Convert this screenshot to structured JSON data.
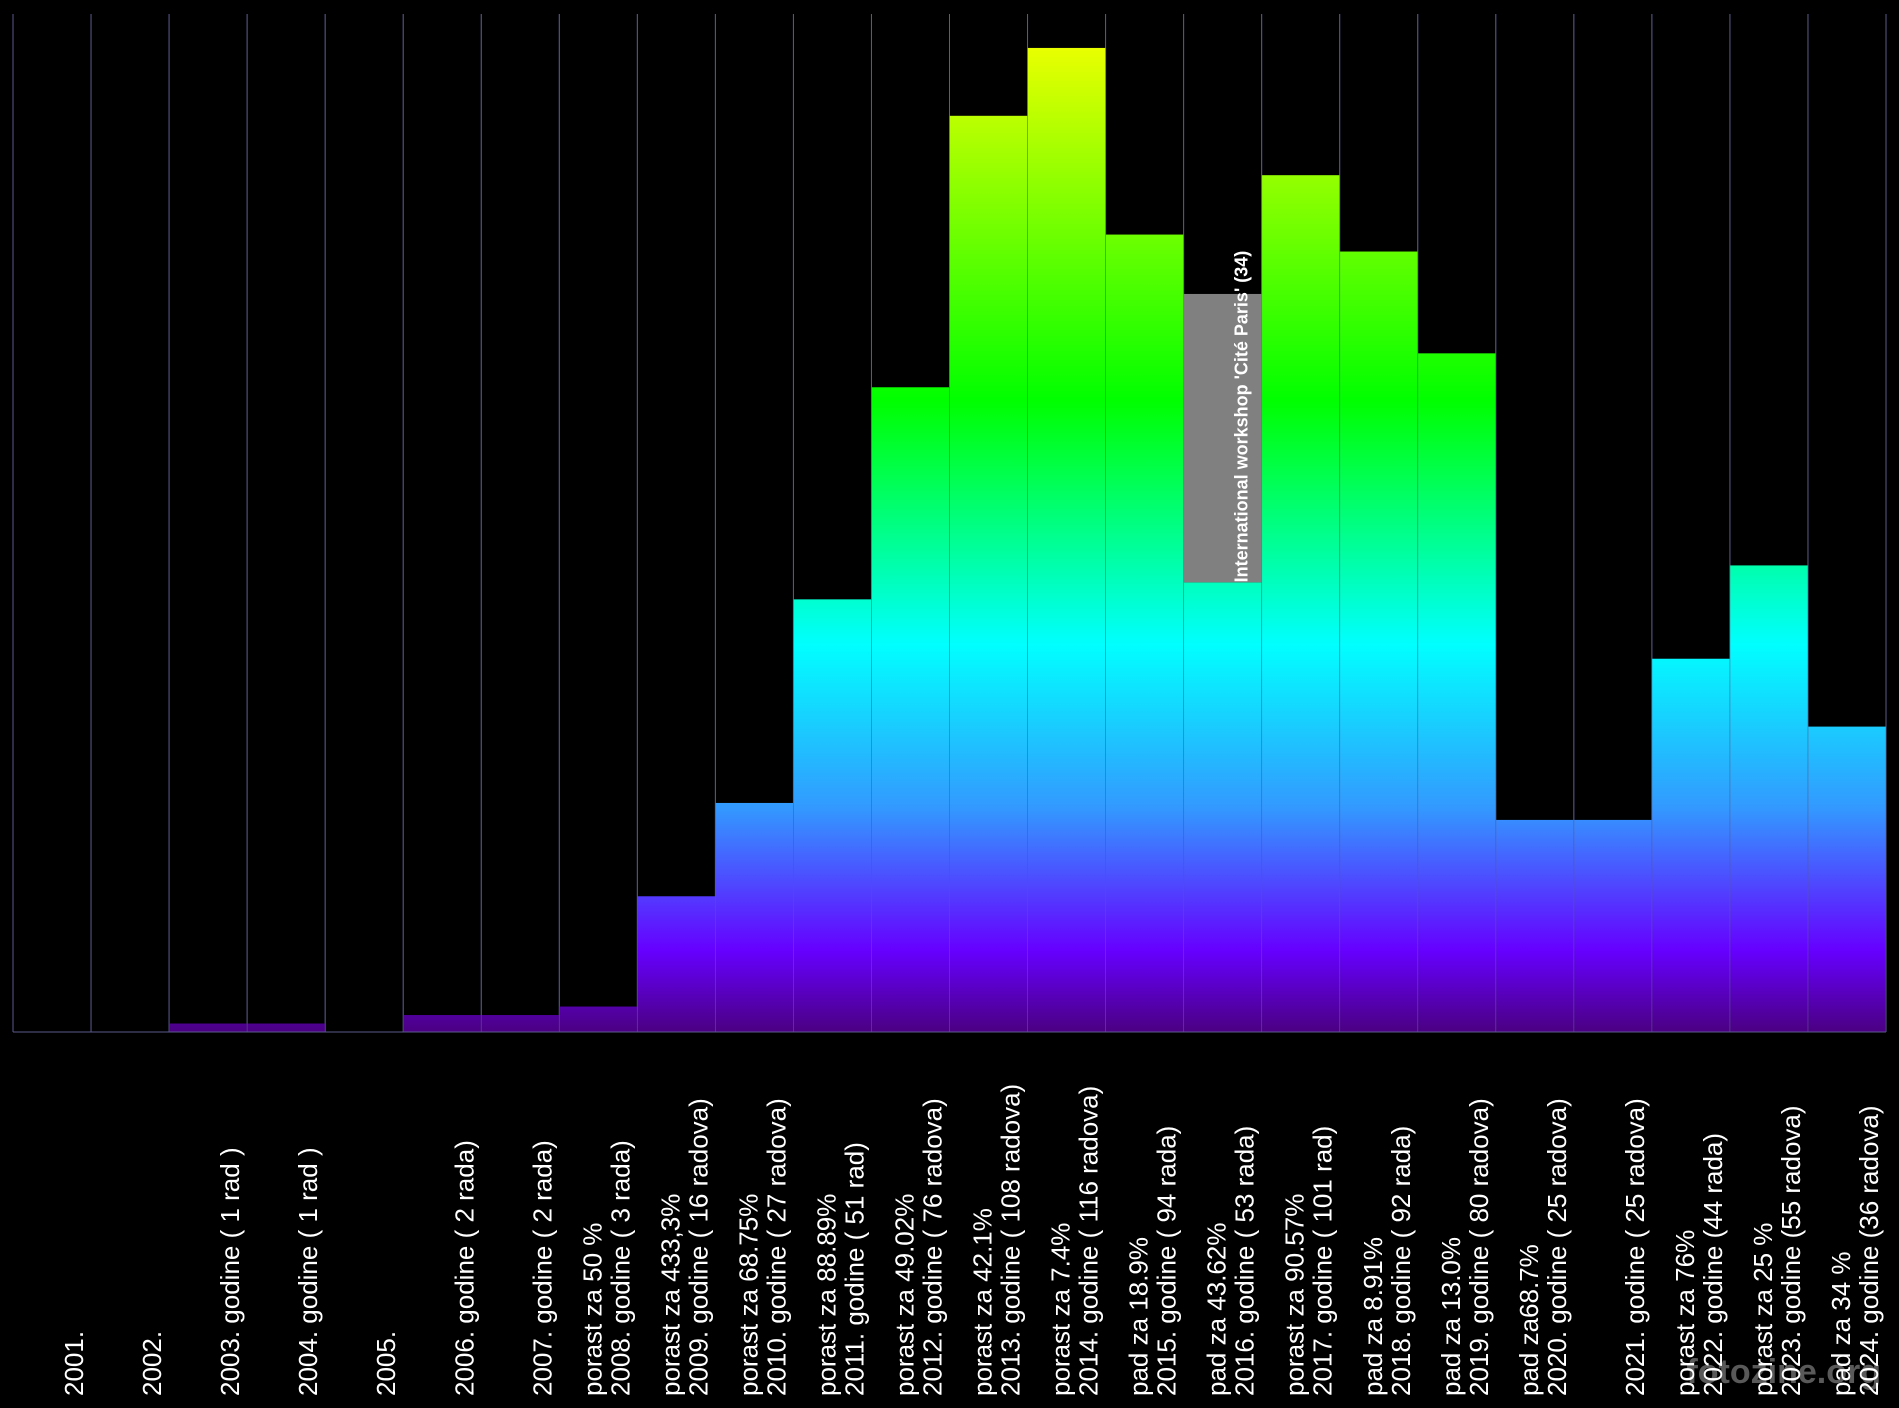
{
  "chart_data": {
    "type": "bar",
    "categories": [
      "2001.",
      "2002.",
      "2003.",
      "2004.",
      "2005.",
      "2006.",
      "2007.",
      "2008.",
      "2009.",
      "2010.",
      "2011.",
      "2012.",
      "2013.",
      "2014.",
      "2015.",
      "2016.",
      "2017.",
      "2018.",
      "2019.",
      "2020.",
      "2021.",
      "2022.",
      "2023.",
      "2024."
    ],
    "values": [
      0,
      0,
      1,
      1,
      0,
      2,
      2,
      3,
      16,
      27,
      51,
      76,
      108,
      116,
      94,
      53,
      101,
      92,
      80,
      25,
      25,
      44,
      55,
      36
    ],
    "labels": [
      [
        "2001."
      ],
      [
        "2002."
      ],
      [
        "2003. godine  ( 1 rad )"
      ],
      [
        "2004. godine  ( 1 rad )"
      ],
      [
        "2005."
      ],
      [
        "2006. godine  ( 2 rada)"
      ],
      [
        "2007. godine  ( 2 rada)"
      ],
      [
        "porast za 50 %",
        "2008. godine  ( 3 rada)"
      ],
      [
        "porast za 433,3%",
        "2009. godine  ( 16 radova)"
      ],
      [
        "porast za 68.75%",
        "2010. godine  ( 27 radova)"
      ],
      [
        "porast za 88.89%",
        "2011. godine  ( 51 rad)"
      ],
      [
        "porast za 49.02%",
        "2012. godine  ( 76 radova)"
      ],
      [
        "porast za 42.1%",
        "2013. godine  ( 108 radova)"
      ],
      [
        "porast za 7.4%",
        "2014. godine  ( 116 radova)"
      ],
      [
        "pad za 18.9%",
        "2015. godine  ( 94 rada)"
      ],
      [
        "pad za 43.62%",
        "2016. godine  ( 53 rada)"
      ],
      [
        "porast za 90.57%",
        "2017. godine  ( 101 rad)"
      ],
      [
        "pad za 8.91%",
        "2018. godine ( 92 rada)"
      ],
      [
        "pad za 13.0%",
        "2019. godine ( 80 radova)"
      ],
      [
        "pad za68.7%",
        "2020. godine ( 25 radova)"
      ],
      [
        "2021. godine ( 25 radova)"
      ],
      [
        "porast za 76%",
        "2022. godine (44 rada)"
      ],
      [
        "porast za 25 %",
        "2023. godine (55 radova)"
      ],
      [
        "pad za 34 %",
        "2024. godine (36 radova)"
      ]
    ],
    "stacked_extra": {
      "category": "2016.",
      "value": 34,
      "label": "International workshop 'Cité Paris' (34)",
      "color": "#808080"
    },
    "ylim": [
      0,
      120
    ],
    "grid": "vertical",
    "title": "",
    "xlabel": "",
    "ylabel": "",
    "colors": {
      "background": "#000000",
      "grid": "#5a5a8c",
      "gradient_top": "#ffff00",
      "gradient_green": "#00ff00",
      "gradient_cyan": "#00ffff",
      "gradient_blue": "#3399ff",
      "gradient_violet": "#6600ff",
      "gradient_bottom": "#4b0082",
      "label": "#ffffff"
    }
  },
  "watermark": "fotozine.org"
}
